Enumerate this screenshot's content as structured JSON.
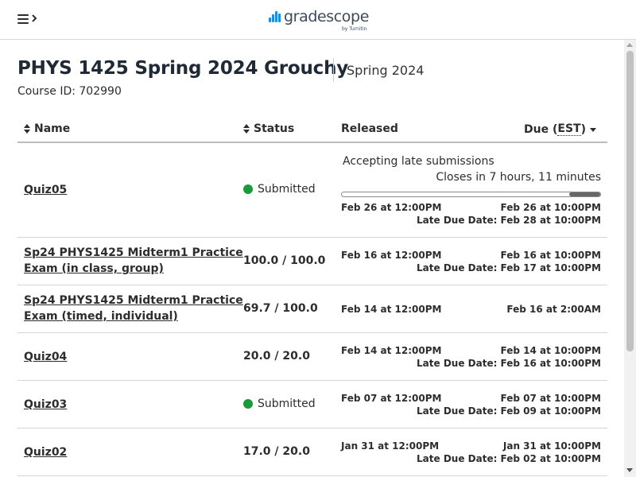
{
  "header": {
    "menu_label": "Menu",
    "logo_text": "gradescope",
    "logo_sub": "by Turnitin",
    "brand_color": "#1d8de0"
  },
  "course": {
    "title": "PHYS 1425 Spring 2024 Grouchy",
    "term": "Spring 2024",
    "course_id": "Course ID: 702990"
  },
  "table": {
    "headers": {
      "name": "Name",
      "status": "Status",
      "released": "Released",
      "due": "Due (",
      "due_tz": "EST",
      "due_close": ")"
    },
    "rows": [
      {
        "name": "Quiz05",
        "status": "Submitted",
        "status_type": "submitted",
        "accepting": "Accepting late submissions",
        "closes": "Closes in 7 hours, 11 minutes",
        "progress_elapsed_fraction": 0.88,
        "released": "Feb 26 at 12:00PM",
        "due": "Feb 26 at 10:00PM",
        "late_due": "Late Due Date: Feb 28 at 10:00PM"
      },
      {
        "name": "Sp24 PHYS1425 Midterm1 Practice Exam (in class, group)",
        "status": "100.0 / 100.0",
        "status_type": "score",
        "released": "Feb 16 at 12:00PM",
        "due": "Feb 16 at 10:00PM",
        "late_due": "Late Due Date: Feb 17 at 10:00PM"
      },
      {
        "name": "Sp24 PHYS1425 Midterm1 Practice Exam (timed, individual)",
        "status": "69.7 / 100.0",
        "status_type": "score",
        "released": "Feb 14 at 12:00PM",
        "due": "Feb 16 at 2:00AM",
        "late_due": ""
      },
      {
        "name": "Quiz04",
        "status": "20.0 / 20.0",
        "status_type": "score",
        "released": "Feb 14 at 12:00PM",
        "due": "Feb 14 at 10:00PM",
        "late_due": "Late Due Date: Feb 16 at 10:00PM"
      },
      {
        "name": "Quiz03",
        "status": "Submitted",
        "status_type": "submitted",
        "released": "Feb 07 at 12:00PM",
        "due": "Feb 07 at 10:00PM",
        "late_due": "Late Due Date: Feb 09 at 10:00PM"
      },
      {
        "name": "Quiz02",
        "status": "17.0 / 20.0",
        "status_type": "score",
        "released": "Jan 31 at 12:00PM",
        "due": "Jan 31 at 10:00PM",
        "late_due": "Late Due Date: Feb 02 at 10:00PM"
      }
    ]
  },
  "colors": {
    "submitted_dot": "#1a9a3a",
    "progress_fill": "#666666"
  }
}
